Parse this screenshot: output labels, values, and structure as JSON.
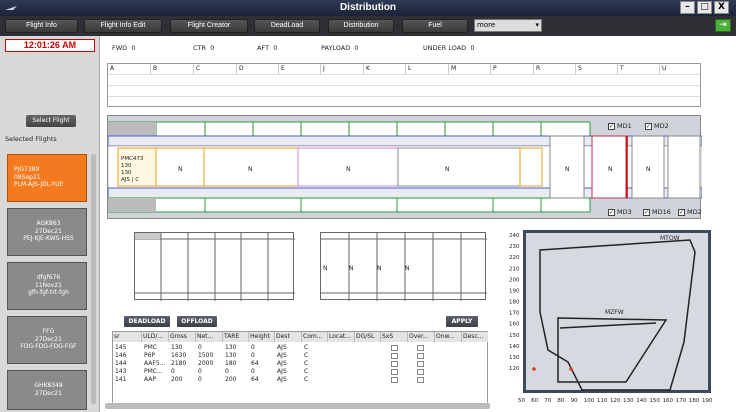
{
  "window": {
    "title": "Distribution",
    "btn_min": "–",
    "btn_max": "□",
    "btn_close": "X"
  },
  "toolbar": {
    "buttons": [
      "Flight Info",
      "Flight Info Edit",
      "Flight Creator",
      "DeadLoad",
      "Distribution",
      "Fuel"
    ],
    "more_label": "more",
    "more_arrow": "▾",
    "exit_icon": "⇥"
  },
  "left": {
    "clock": "12:01:26 AM",
    "select_button": "Select Flight",
    "selected_label": "Selected Flights",
    "flights": [
      {
        "line1": "PJG7389",
        "line2": "08Sep21",
        "line3": "PLM-AJS-JDL-YUE"
      },
      {
        "line1": "AGK863",
        "line2": "27Dec21",
        "line3": "PEJ-KJE-KWS-HSS"
      },
      {
        "line1": "dfgf676",
        "line2": "11Nov21",
        "line3": "gfh-fgf-trt-fgh"
      },
      {
        "line1": "FFG",
        "line2": "27Dec21",
        "line3": "FDG-FDG-FDG-FGF"
      },
      {
        "line1": "GHK8348",
        "line2": "27Dec21",
        "line3": ""
      }
    ]
  },
  "summary": {
    "fwd_label": "FWD",
    "fwd_value": "0",
    "ctr_label": "CTR",
    "ctr_value": "0",
    "aft_label": "AFT",
    "aft_value": "0",
    "payload_label": "PAYLOAD",
    "payload_value": "0",
    "underload_label": "UNDER LOAD",
    "underload_value": "0"
  },
  "grid_columns": [
    "A",
    "B",
    "C",
    "D",
    "E",
    "J",
    "K",
    "L",
    "M",
    "P",
    "R",
    "S",
    "T",
    "U"
  ],
  "fuselage": {
    "uld_label": [
      "PMC473",
      "130",
      "130",
      "AJS | C"
    ],
    "positions": [
      "N",
      "N",
      "N",
      "N",
      "N",
      "N",
      "N"
    ],
    "checkboxes_top": [
      "MD1",
      "MD2"
    ],
    "checkboxes_bottom": [
      "MD3",
      "MD16",
      "MD2"
    ],
    "check_mark": "✓"
  },
  "deckB_labels": [
    "N",
    "N",
    "N",
    "N"
  ],
  "actions": {
    "deadload": "DEADLOAD",
    "offload": "OFFLOAD",
    "apply": "APPLY"
  },
  "table": {
    "headers": [
      "sr",
      "ULD/...",
      "Gross",
      "Net...",
      "TARE",
      "Height",
      "Dest",
      "Com...",
      "Locat...",
      "DG/SL",
      "SxS",
      "Over...",
      "Onw...",
      "Desc..."
    ],
    "rows": [
      [
        "145",
        "PMC",
        "130",
        "0",
        "130",
        "0",
        "AJS",
        "C"
      ],
      [
        "146",
        "P6P",
        "1630",
        "1500",
        "130",
        "0",
        "AJS",
        "C"
      ],
      [
        "144",
        "AAF5...",
        "2180",
        "2000",
        "180",
        "64",
        "AJS",
        "C"
      ],
      [
        "143",
        "PMC...",
        "0",
        "0",
        "0",
        "0",
        "AJS",
        "C"
      ],
      [
        "141",
        "AAP",
        "200",
        "0",
        "200",
        "64",
        "AJS",
        "C"
      ]
    ]
  },
  "envelope": {
    "mtow_label": "MTOW",
    "mzfw_label": "MZFW",
    "y_ticks": [
      "240",
      "230",
      "220",
      "210",
      "200",
      "190",
      "180",
      "170",
      "160",
      "150",
      "140",
      "130",
      "120"
    ],
    "x_ticks": [
      "50",
      "60",
      "70",
      "80",
      "90",
      "100",
      "110",
      "120",
      "130",
      "140",
      "150",
      "160",
      "170",
      "180",
      "190"
    ],
    "bg_color": "#3d4a5c",
    "plot_color": "#d6dae0",
    "line_color": "#222222",
    "marker_color": "#e03a1e"
  }
}
